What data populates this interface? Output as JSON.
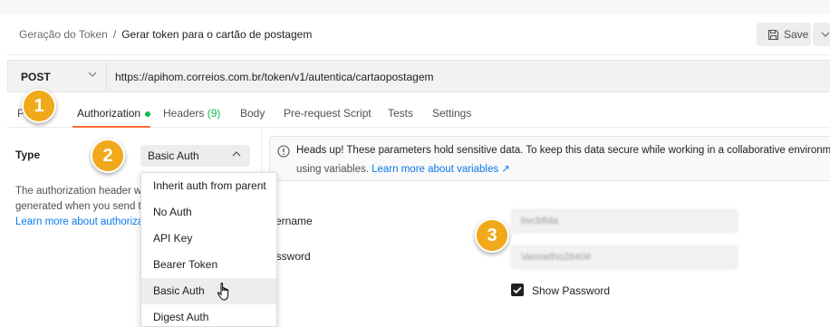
{
  "header": {
    "breadcrumb_parent": "Geração do Token",
    "breadcrumb_separator": "/",
    "breadcrumb_current": "Gerar token para o cartão de postagem",
    "save_label": "Save"
  },
  "request": {
    "method": "POST",
    "url": "https://apihom.correios.com.br/token/v1/autentica/cartaopostagem"
  },
  "tabs": [
    {
      "label": "P"
    },
    {
      "label": "Authorization"
    },
    {
      "label": "Headers",
      "count": "(9)"
    },
    {
      "label": "Body"
    },
    {
      "label": "Pre-request Script"
    },
    {
      "label": "Tests"
    },
    {
      "label": "Settings"
    }
  ],
  "auth": {
    "type_label": "Type",
    "selected": "Basic Auth",
    "description_lines": [
      "The authorization header w",
      "generated when you send t",
      "Learn more about authoriza"
    ],
    "options": [
      "Inherit auth from parent",
      "No Auth",
      "API Key",
      "Bearer Token",
      "Basic Auth",
      "Digest Auth"
    ]
  },
  "notice": {
    "line1": "Heads up! These parameters hold sensitive data. To keep this data secure while working in a collaborative environme",
    "line2_prefix": "using variables.",
    "line2_link": "Learn more about variables ↗"
  },
  "fields": {
    "username_label": "sername",
    "username_value": "bvcbfida",
    "password_label": "assword",
    "password_value": "Vermelho2840#",
    "show_password_label": "Show Password"
  },
  "badges": [
    "1",
    "2",
    "3"
  ],
  "colors": {
    "accent_orange": "#ff6c37",
    "status_green": "#0cbb52",
    "link_blue": "#097bed",
    "badge_gold": "#f0a91a"
  }
}
